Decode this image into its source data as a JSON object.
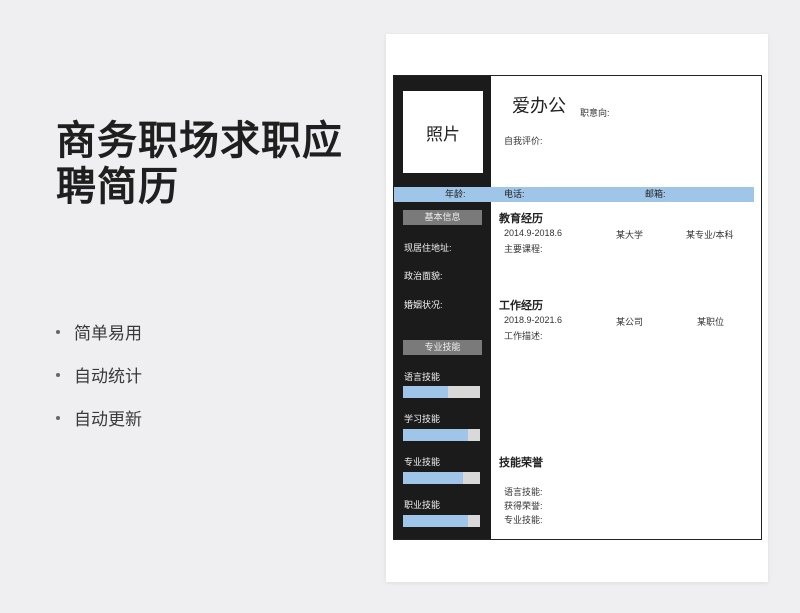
{
  "title_lines": [
    "商务职场求职应",
    "聘简历"
  ],
  "features": [
    "简单易用",
    "自动统计",
    "自动更新"
  ],
  "resume": {
    "photo_label": "照片",
    "name": "爱办公",
    "job_intent": "职意向:",
    "self_eval": "自我评价:",
    "info_bar": {
      "age": "年龄:",
      "phone": "电话:",
      "email": "邮箱:"
    },
    "basic_info": {
      "title": "基本信息",
      "fields": [
        "现居住地址:",
        "政治面貌:",
        "婚姻状况:"
      ]
    },
    "skills": {
      "title": "专业技能",
      "items": [
        {
          "label": "语言技能",
          "level": 0.58
        },
        {
          "label": "学习技能",
          "level": 0.85
        },
        {
          "label": "专业技能",
          "level": 0.78
        },
        {
          "label": "职业技能",
          "level": 0.85
        }
      ]
    },
    "education": {
      "title": "教育经历",
      "period": "2014.9-2018.6",
      "school": "某大学",
      "major": "某专业/本科",
      "courses_label": "主要课程:"
    },
    "work": {
      "title": "工作经历",
      "period": "2018.9-2021.6",
      "company": "某公司",
      "position": "某职位",
      "desc_label": "工作描述:"
    },
    "honors": {
      "title": "技能荣誉",
      "items": [
        "语言技能:",
        "获得荣誉:",
        "专业技能:"
      ]
    }
  }
}
